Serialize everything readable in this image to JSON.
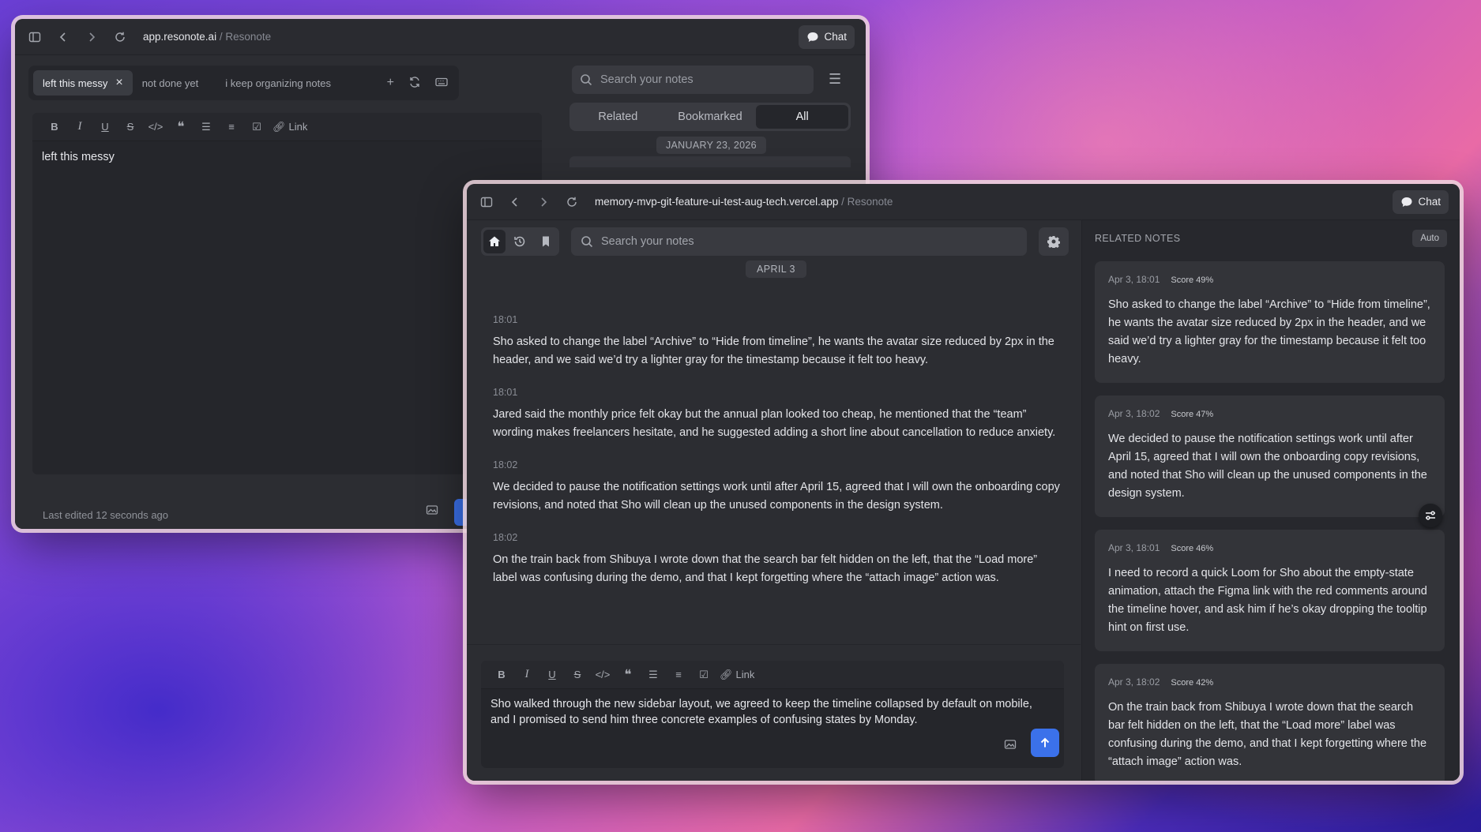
{
  "window1": {
    "url_host": "app.resonote.ai",
    "url_suffix": " / Resonote",
    "chat_label": "Chat",
    "tabs": [
      {
        "label": "left this messy",
        "active": true
      },
      {
        "label": "not done yet",
        "active": false
      },
      {
        "label": "i keep organizing notes",
        "active": false
      }
    ],
    "editor_text": "left this messy",
    "link_label": "Link",
    "last_edited": "Last edited 12 seconds ago",
    "search_placeholder": "Search your notes",
    "segments": [
      "Related",
      "Bookmarked",
      "All"
    ],
    "active_segment": "All",
    "date_label": "JANUARY 23, 2026"
  },
  "window2": {
    "url_host": "memory-mvp-git-feature-ui-test-aug-tech.vercel.app",
    "url_suffix": " / Resonote",
    "chat_label": "Chat",
    "search_placeholder": "Search your notes",
    "date_label": "APRIL 3",
    "notes": [
      {
        "time": "18:01",
        "text": "Sho asked to change the label “Archive” to “Hide from timeline”, he wants the avatar size reduced by 2px in the header, and we said we’d try a lighter gray for the timestamp because it felt too heavy."
      },
      {
        "time": "18:01",
        "text": "Jared said the monthly price felt okay but the annual plan looked too cheap, he mentioned that the “team” wording makes freelancers hesitate, and he suggested adding a short line about cancellation to reduce anxiety."
      },
      {
        "time": "18:02",
        "text": "We decided to pause the notification settings work until after April 15, agreed that I will own the onboarding copy revisions, and noted that Sho will clean up the unused components in the design system."
      },
      {
        "time": "18:02",
        "text": "On the train back from Shibuya I wrote down that the search bar felt hidden on the left, that the “Load more” label was confusing during the demo, and that I kept forgetting where the “attach image” action was."
      }
    ],
    "link_label": "Link",
    "compose_text": "Sho walked through the new sidebar layout, we agreed to keep the timeline collapsed by default on mobile, and I promised to send him three concrete examples of confusing states by Monday.",
    "related_header": "RELATED NOTES",
    "auto_label": "Auto",
    "related": [
      {
        "date": "Apr 3, 18:01",
        "score": "Score 49%",
        "text": "Sho asked to change the label “Archive” to “Hide from timeline”, he wants the avatar size reduced by 2px in the header, and we said we’d try a lighter gray for the timestamp because it felt too heavy."
      },
      {
        "date": "Apr 3, 18:02",
        "score": "Score 47%",
        "text": "We decided to pause the notification settings work until after April 15, agreed that I will own the onboarding copy revisions, and noted that Sho will clean up the unused components in the design system."
      },
      {
        "date": "Apr 3, 18:01",
        "score": "Score 46%",
        "text": "I need to record a quick Loom for Sho about the empty-state animation, attach the Figma link with the red comments around the timeline hover, and ask him if he’s okay dropping the tooltip hint on first use."
      },
      {
        "date": "Apr 3, 18:02",
        "score": "Score 42%",
        "text": "On the train back from Shibuya I wrote down that the search bar felt hidden on the left, that the “Load more” label was confusing during the demo, and that I kept forgetting where the “attach image” action was."
      }
    ],
    "accent_color": "#3b71ea"
  }
}
